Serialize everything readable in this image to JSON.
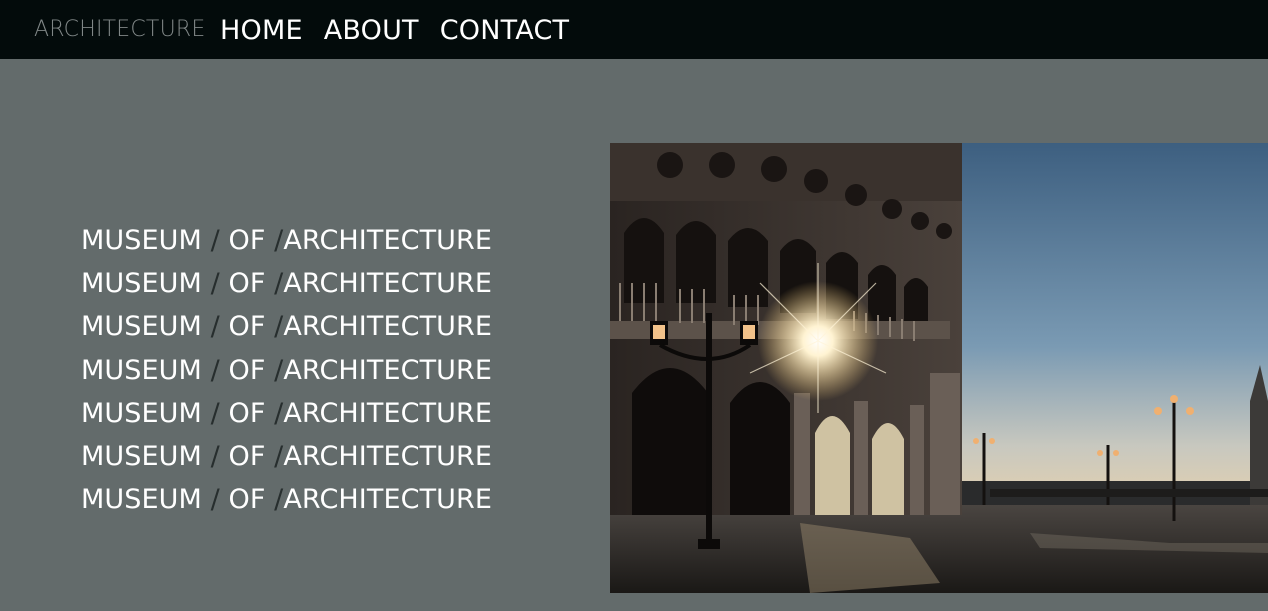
{
  "header": {
    "brand": "ARCHITECTURE",
    "nav": [
      {
        "label": "HOME"
      },
      {
        "label": "ABOUT"
      },
      {
        "label": "CONTACT"
      }
    ]
  },
  "hero": {
    "lines": [
      {
        "a": "MUSEUM",
        "s1": " / ",
        "b": "OF",
        "s2": " /",
        "c": "ARCHITECTURE"
      },
      {
        "a": "MUSEUM",
        "s1": " / ",
        "b": "OF",
        "s2": " /",
        "c": "ARCHITECTURE"
      },
      {
        "a": "MUSEUM",
        "s1": " / ",
        "b": "OF",
        "s2": " /",
        "c": "ARCHITECTURE"
      },
      {
        "a": "MUSEUM",
        "s1": " / ",
        "b": "OF",
        "s2": " /",
        "c": "ARCHITECTURE"
      },
      {
        "a": "MUSEUM",
        "s1": " / ",
        "b": "OF",
        "s2": " /",
        "c": "ARCHITECTURE"
      },
      {
        "a": "MUSEUM",
        "s1": " / ",
        "b": "OF",
        "s2": " /",
        "c": "ARCHITECTURE"
      },
      {
        "a": "MUSEUM",
        "s1": " / ",
        "b": "OF",
        "s2": " /",
        "c": "ARCHITECTURE"
      }
    ]
  },
  "colors": {
    "background": "#636b6b",
    "topbar": "#030b0b",
    "brand_text": "#808787",
    "slash": "#272e2e",
    "text": "#ffffff"
  }
}
